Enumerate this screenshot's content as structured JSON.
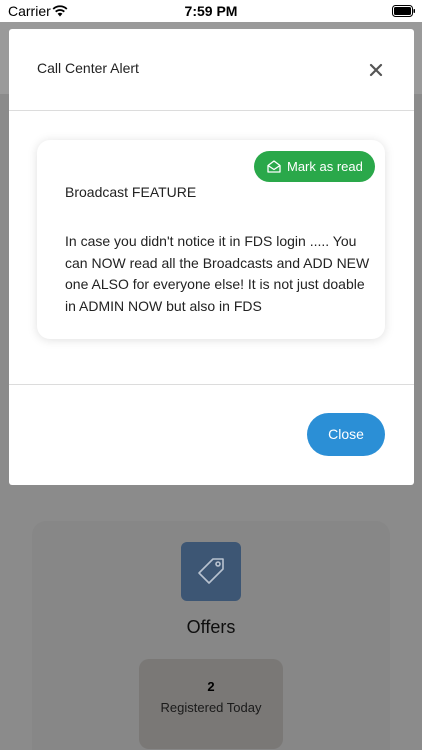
{
  "status_bar": {
    "carrier": "Carrier",
    "time": "7:59 PM"
  },
  "modal": {
    "title": "Call Center Alert",
    "close_icon": "close-icon",
    "alert": {
      "mark_read_label": "Mark as read",
      "mark_read_icon": "envelope-open-icon",
      "title": "Broadcast FEATURE",
      "body": "In case you didn't notice it in FDS login ..... You can NOW read all the Broadcasts and ADD NEW one ALSO for everyone else! It is not just doable in ADMIN NOW but also in FDS"
    },
    "close_button_label": "Close"
  },
  "background": {
    "offers": {
      "icon": "tag-icon",
      "title": "Offers",
      "stat_value": "2",
      "stat_label": "Registered Today"
    }
  },
  "colors": {
    "mark_read_green": "#2aa84a",
    "close_button_blue": "#2b8fd6",
    "offers_icon_bg": "#3d5674"
  }
}
